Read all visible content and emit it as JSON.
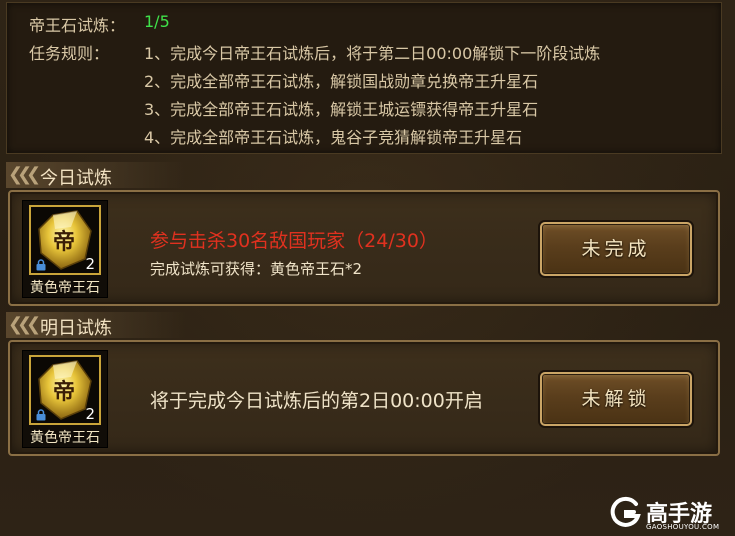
{
  "rules": {
    "progress_label": "帝王石试炼：",
    "progress_value": "1/5",
    "rules_label": "任务规则：",
    "items": [
      "1、完成今日帝王石试炼后，将于第二日00:00解锁下一阶段试炼",
      "2、完成全部帝王石试炼，解锁国战勋章兑换帝王升星石",
      "3、完成全部帝王石试炼，解锁王城运镖获得帝王升星石",
      "4、完成全部帝王石试炼，鬼谷子竞猜解锁帝王升星石"
    ]
  },
  "today": {
    "section_title": "今日试炼",
    "item_name": "黄色帝王石",
    "item_count": "2",
    "task_text": "参与击杀30名敌国玩家（24/30）",
    "reward_text": "完成试炼可获得：黄色帝王石*2",
    "button_label": "未完成"
  },
  "tomorrow": {
    "section_title": "明日试炼",
    "item_name": "黄色帝王石",
    "item_count": "2",
    "task_text": "将于完成今日试炼后的第2日00:00开启",
    "button_label": "未解锁"
  },
  "watermark": {
    "brand": "高手游",
    "domain": "GAOSHOUYOU.COM"
  },
  "colors": {
    "progress_green": "#3fe24a",
    "task_red": "#e0311f",
    "gold_frame": "#c9a43a"
  }
}
